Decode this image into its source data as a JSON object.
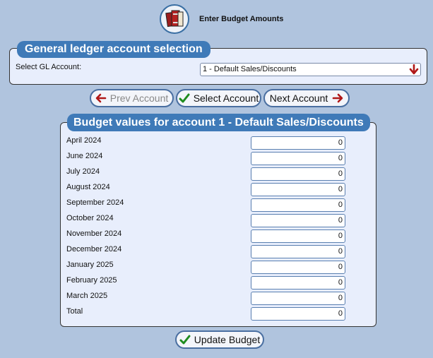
{
  "header": {
    "title": "Enter Budget Amounts",
    "logo_icon": "books-icon"
  },
  "gl_selection": {
    "legend": "General ledger account selection",
    "label": "Select GL Account:",
    "selected_value": "1 - Default Sales/Discounts"
  },
  "nav": {
    "prev_label": "Prev Account",
    "select_label": "Select Account",
    "next_label": "Next Account"
  },
  "budget": {
    "legend": "Budget values for account 1 - Default Sales/Discounts",
    "rows": [
      {
        "label": "April 2024",
        "value": "0"
      },
      {
        "label": "June 2024",
        "value": "0"
      },
      {
        "label": "July 2024",
        "value": "0"
      },
      {
        "label": "August 2024",
        "value": "0"
      },
      {
        "label": "September 2024",
        "value": "0"
      },
      {
        "label": "October 2024",
        "value": "0"
      },
      {
        "label": "November 2024",
        "value": "0"
      },
      {
        "label": "December 2024",
        "value": "0"
      },
      {
        "label": "January 2025",
        "value": "0"
      },
      {
        "label": "February 2025",
        "value": "0"
      },
      {
        "label": "March 2025",
        "value": "0"
      },
      {
        "label": "Total",
        "value": "0"
      }
    ]
  },
  "update_label": "Update Budget",
  "colors": {
    "background": "#b0c4de",
    "legend": "#3f7ab8",
    "arrow_red": "#b01818",
    "check_green": "#1e8c1e"
  }
}
